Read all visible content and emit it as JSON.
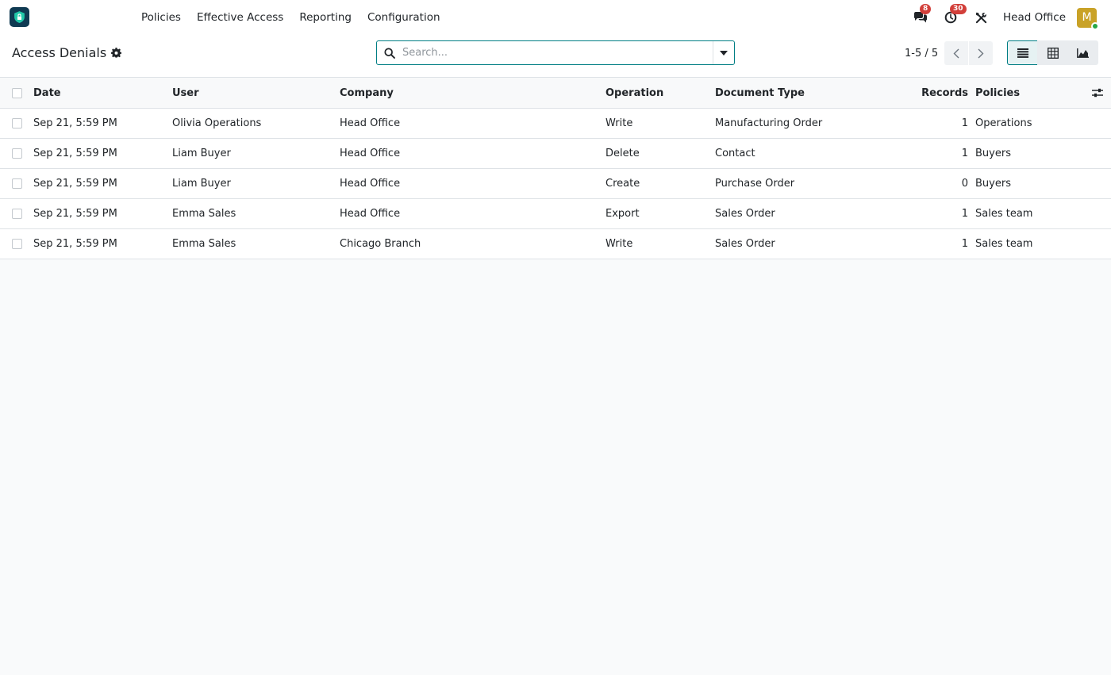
{
  "navbar": {
    "menu": [
      "Policies",
      "Effective Access",
      "Reporting",
      "Configuration"
    ],
    "messages_count": "8",
    "activities_count": "30",
    "company": "Head Office",
    "avatar_initial": "M"
  },
  "control_panel": {
    "title": "Access Denials",
    "search_placeholder": "Search...",
    "pager": "1-5 / 5"
  },
  "table": {
    "columns": {
      "date": "Date",
      "user": "User",
      "company": "Company",
      "operation": "Operation",
      "document_type": "Document Type",
      "records": "Records",
      "policies": "Policies"
    },
    "rows": [
      {
        "date": "Sep 21, 5:59 PM",
        "user": "Olivia Operations",
        "company": "Head Office",
        "operation": "Write",
        "document_type": "Manufacturing Order",
        "records": "1",
        "policies": "Operations"
      },
      {
        "date": "Sep 21, 5:59 PM",
        "user": "Liam Buyer",
        "company": "Head Office",
        "operation": "Delete",
        "document_type": "Contact",
        "records": "1",
        "policies": "Buyers"
      },
      {
        "date": "Sep 21, 5:59 PM",
        "user": "Liam Buyer",
        "company": "Head Office",
        "operation": "Create",
        "document_type": "Purchase Order",
        "records": "0",
        "policies": "Buyers"
      },
      {
        "date": "Sep 21, 5:59 PM",
        "user": "Emma Sales",
        "company": "Head Office",
        "operation": "Export",
        "document_type": "Sales Order",
        "records": "1",
        "policies": "Sales team"
      },
      {
        "date": "Sep 21, 5:59 PM",
        "user": "Emma Sales",
        "company": "Chicago Branch",
        "operation": "Write",
        "document_type": "Sales Order",
        "records": "1",
        "policies": "Sales team"
      }
    ]
  },
  "icons": {
    "app": "shield-lock-icon",
    "messages": "chat-bubbles-icon",
    "activities": "clock-icon",
    "debug": "tools-icon",
    "settings": "gear-icon",
    "search": "search-icon",
    "toggle": "caret-down-icon",
    "prev": "chevron-left-icon",
    "next": "chevron-right-icon",
    "list_view": "list-icon",
    "pivot_view": "table-grid-icon",
    "graph_view": "area-chart-icon",
    "optional_columns": "sliders-icon"
  },
  "colors": {
    "accent": "#017e84",
    "badge": "#d23f3a",
    "avatar": "#c9a227",
    "app_logo": "#0f3a52"
  }
}
